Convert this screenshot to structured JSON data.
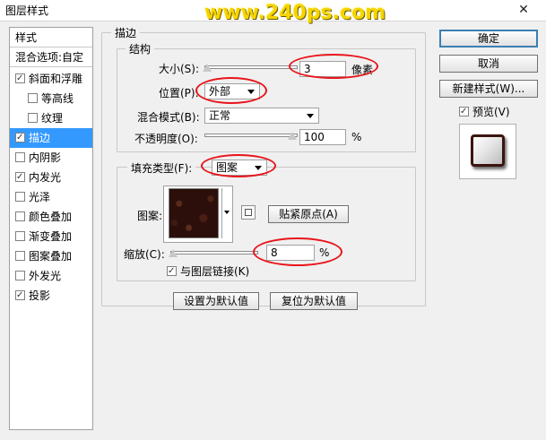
{
  "window": {
    "title": "图层样式",
    "watermark": "www.240ps.com",
    "close": "✕"
  },
  "sidebar": {
    "head": "样式",
    "blend": "混合选项:自定",
    "items": [
      {
        "label": "斜面和浮雕",
        "checked": true
      },
      {
        "label": "等高线",
        "checked": false
      },
      {
        "label": "纹理",
        "checked": false
      },
      {
        "label": "描边",
        "checked": true,
        "selected": true
      },
      {
        "label": "内阴影",
        "checked": false
      },
      {
        "label": "内发光",
        "checked": true
      },
      {
        "label": "光泽",
        "checked": false
      },
      {
        "label": "颜色叠加",
        "checked": false
      },
      {
        "label": "渐变叠加",
        "checked": false
      },
      {
        "label": "图案叠加",
        "checked": false
      },
      {
        "label": "外发光",
        "checked": false
      },
      {
        "label": "投影",
        "checked": true
      }
    ]
  },
  "stroke": {
    "group_title": "描边",
    "structure_title": "结构",
    "size_label": "大小(S):",
    "size_value": "3",
    "size_unit": "像素",
    "position_label": "位置(P):",
    "position_value": "外部",
    "blend_label": "混合模式(B):",
    "blend_value": "正常",
    "opacity_label": "不透明度(O):",
    "opacity_value": "100",
    "opacity_unit": "%",
    "fill_type_label": "填充类型(F):",
    "fill_type_value": "图案",
    "pattern_label": "图案:",
    "snap_button": "贴紧原点(A)",
    "scale_label": "缩放(C):",
    "scale_value": "8",
    "scale_unit": "%",
    "link_label": "与图层链接(K)",
    "link_checked": true,
    "default_button": "设置为默认值",
    "reset_button": "复位为默认值"
  },
  "actions": {
    "ok": "确定",
    "cancel": "取消",
    "new_style": "新建样式(W)...",
    "preview_label": "预览(V)",
    "preview_checked": true
  },
  "colors": {
    "accent": "#3399ff",
    "highlight_ring": "#e8141a",
    "watermark": "#f5d400"
  }
}
